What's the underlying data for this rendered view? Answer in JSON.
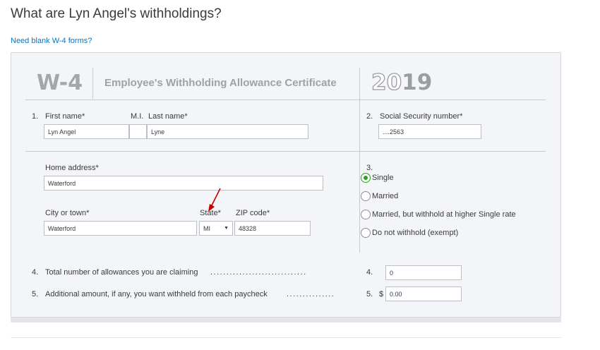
{
  "page": {
    "title": "What are Lyn Angel's withholdings?",
    "blank_forms_link": "Need blank W-4 forms?"
  },
  "form": {
    "code": "W-4",
    "title": "Employee's Withholding Allowance Certificate",
    "year_prefix": "20",
    "year_suffix": "19"
  },
  "section1": {
    "number": "1.",
    "first_name_label": "First name*",
    "mi_label": "M.I.",
    "last_name_label": "Last name*",
    "first_name_value": "Lyn Angel",
    "mi_value": "",
    "last_name_value": "Lyne"
  },
  "section2": {
    "number": "2.",
    "ssn_label": "Social Security number*",
    "ssn_value": "....2563"
  },
  "address": {
    "home_label": "Home address*",
    "home_value": "Waterford",
    "city_label": "City or town*",
    "city_value": "Waterford",
    "state_label": "State*",
    "state_value": "MI",
    "zip_label": "ZIP code*",
    "zip_value": "48328"
  },
  "section3": {
    "number": "3.",
    "selected": "Single",
    "options": [
      "Single",
      "Married",
      "Married, but withhold at higher Single rate",
      "Do not withhold (exempt)"
    ]
  },
  "section4": {
    "number": "4.",
    "label": "Total number of allowances you are claiming",
    "dots": "..............................",
    "field_number": "4.",
    "value": "0"
  },
  "section5": {
    "number": "5.",
    "label": "Additional amount, if any, you want withheld from each paycheck",
    "dots": "...............",
    "field_number": "5.",
    "currency": "$",
    "value": "0.00"
  },
  "colors": {
    "link": "#0077c5",
    "radio_selected": "#2ca01c",
    "annotation_arrow": "#c00000"
  }
}
